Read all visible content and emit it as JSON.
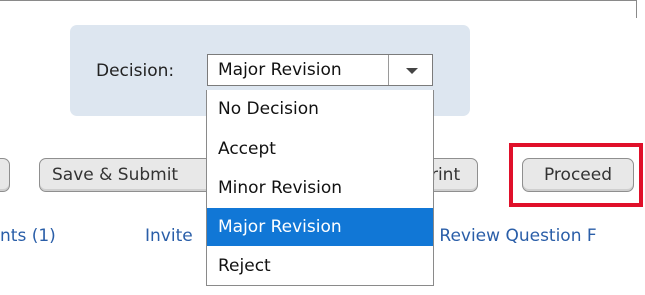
{
  "decision": {
    "label": "Decision:",
    "selected_value": "Major Revision",
    "options": [
      "No Decision",
      "Accept",
      "Minor Revision",
      "Major Revision",
      "Reject"
    ],
    "highlighted_option": "Major Revision"
  },
  "buttons": {
    "save_label": "Save & Submit",
    "print_label": "Print",
    "proceed_label": "Proceed"
  },
  "links": {
    "comments_label": "nts (1)",
    "invite_label": "Invite",
    "review_label": "r Review Question F"
  },
  "colors": {
    "panel_bg": "#dde6f0",
    "highlight_border": "#e0102a",
    "selected_option_bg": "#1177d6",
    "link": "#2a5ea8"
  },
  "icons": {
    "dropdown_arrow": "chevron-down-icon"
  }
}
